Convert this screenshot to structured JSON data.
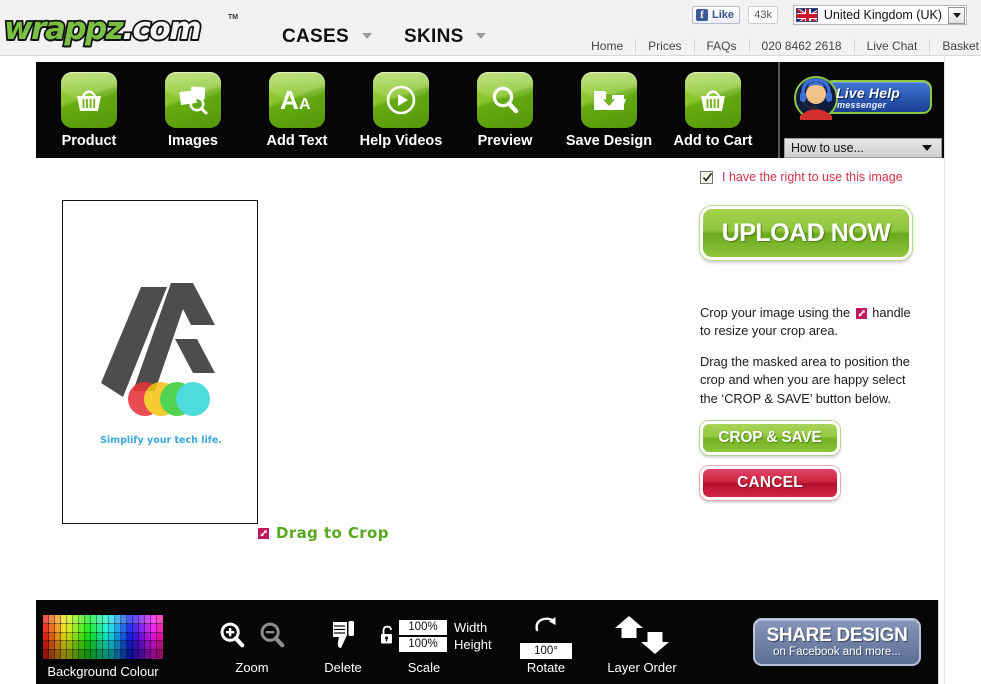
{
  "header": {
    "logo": {
      "green": "wrappz",
      "white": ".com",
      "tm": "TM"
    },
    "main_nav": [
      {
        "label": "CASES",
        "icon": "chevron-down-icon"
      },
      {
        "label": "SKINS",
        "icon": "chevron-down-icon"
      }
    ],
    "facebook": {
      "like_label": "Like",
      "count": "43k",
      "icon": "facebook-icon"
    },
    "country": {
      "name": "United Kingdom (UK)",
      "flag": "uk-flag-icon",
      "icon": "chevron-down-icon"
    },
    "util_nav": [
      "Home",
      "Prices",
      "FAQs",
      "020 8462 2618",
      "Live Chat",
      "Basket"
    ]
  },
  "toolbar": {
    "tools": [
      {
        "label": "Product",
        "icon": "basket-icon"
      },
      {
        "label": "Images",
        "icon": "photos-search-icon"
      },
      {
        "label": "Add Text",
        "icon": "font-aa-icon"
      },
      {
        "label": "Help Videos",
        "icon": "play-circle-icon"
      },
      {
        "label": "Preview",
        "icon": "magnifier-icon"
      },
      {
        "label": "Save Design",
        "icon": "folder-download-icon"
      },
      {
        "label": "Add to Cart",
        "icon": "basket-icon"
      }
    ],
    "live_help": {
      "title": "Live Help",
      "subtitle": "messenger",
      "avatar_icon": "headset-operator-icon",
      "dropdown_label": "How to use...",
      "dropdown_icon": "chevron-down-icon"
    }
  },
  "canvas": {
    "artwork": {
      "tagline": "Simplify your tech life.",
      "logo_color": "#4d4d4d",
      "dot_colors": [
        "#e8343c",
        "#f5c518",
        "#3bcf3b",
        "#35d7d7"
      ],
      "tagline_color": "#3aa8e0"
    },
    "drag_hint": {
      "label": "Drag to Crop",
      "icon": "resize-handle-icon"
    }
  },
  "right_panel": {
    "rights_checkbox": {
      "label": "I have the right to use this image",
      "checked": true,
      "icon": "checkbox-checked-icon"
    },
    "upload_button": "UPLOAD NOW",
    "instructions": {
      "line1_before": "Crop your image using the",
      "line1_after": "handle to resize your crop area.",
      "handle_icon": "resize-handle-icon",
      "paragraph2": "Drag the masked area to position the crop and when you are happy select the ‘CROP & SAVE’ button below."
    },
    "crop_save_button": "CROP & SAVE",
    "cancel_button": "CANCEL"
  },
  "bottom_bar": {
    "background_colour": {
      "label": "Background Colour",
      "icon": "colour-palette-icon"
    },
    "zoom": {
      "label": "Zoom",
      "in_icon": "zoom-in-icon",
      "out_icon": "zoom-out-icon"
    },
    "delete": {
      "label": "Delete",
      "icon": "thumbs-down-icon"
    },
    "scale": {
      "label": "Scale",
      "lock_icon": "padlock-open-icon",
      "width_value": "100%",
      "width_label": "Width",
      "height_value": "100%",
      "height_label": "Height"
    },
    "rotate": {
      "label": "Rotate",
      "value": "100°",
      "icon": "rotate-cw-icon"
    },
    "layer_order": {
      "label": "Layer Order",
      "up_icon": "arrow-up-icon",
      "down_icon": "arrow-down-icon"
    },
    "share": {
      "title": "SHARE DESIGN",
      "subtitle": "on Facebook and more...",
      "icon": "share-icon"
    }
  },
  "colors": {
    "accent_green": "#8fc63d",
    "toolbar_black": "#060606",
    "cancel_red": "#d0253f",
    "rights_text_red": "#d4314b",
    "link_blue": "#3aa8e0"
  }
}
